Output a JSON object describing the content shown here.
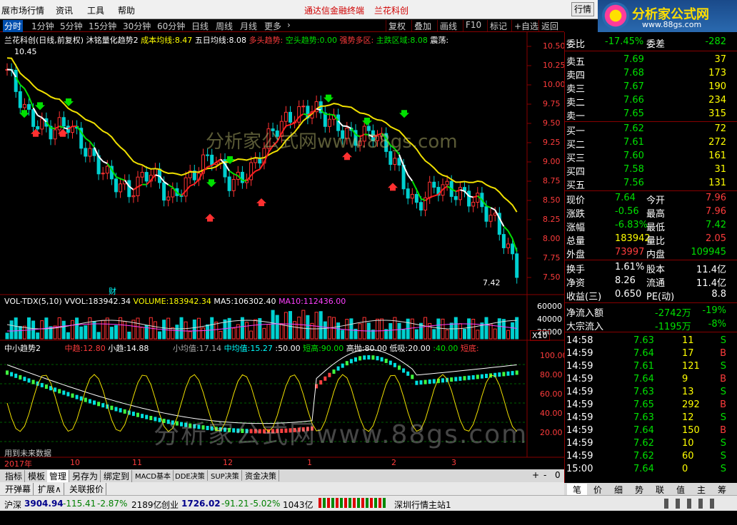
{
  "menubar": {
    "items": [
      "展市场行情",
      "资讯",
      "工具",
      "帮助"
    ],
    "center_title": "通达信金融终端",
    "center_stock": "兰花科创",
    "right_btn": "行情"
  },
  "logo": {
    "main": "分析家公式网",
    "url": "www.88gs.com"
  },
  "periods": [
    "分时",
    "1分钟",
    "5分钟",
    "15分钟",
    "30分钟",
    "60分钟",
    "日线",
    "周线",
    "月线",
    "更多",
    "›"
  ],
  "right_buttons": [
    "复权",
    "叠加",
    "画线",
    "F10",
    "标记",
    "+自选",
    "返回"
  ],
  "main_info": {
    "title": "兰花科创(日线,前复权)",
    "indicator": "沐铭量化趋势2",
    "cost_label": "成本均线:",
    "cost_val": "8.47",
    "ma5_label": "五日均线:",
    "ma5_val": "8.08",
    "bull_label": "多头趋势:",
    "bear_label": "空头趋势:",
    "bear_val": "0.00",
    "strong_label": "强势多区:",
    "rise_label": "主跌区域:",
    "rise_val": "8.08",
    "osc_label": "震荡:"
  },
  "main_chart": {
    "high_label": "10.45",
    "low_label": "7.42",
    "fin_mark": "财",
    "price_ticks": [
      "10.50",
      "10.25",
      "10.00",
      "9.75",
      "9.50",
      "9.25",
      "9.00",
      "8.75",
      "8.50",
      "8.25",
      "8.00",
      "7.75",
      "7.50"
    ]
  },
  "vol_info": {
    "title": "VOL-TDX(5,10)",
    "vvol_label": "VVOL:",
    "vvol": "183942.34",
    "volume_label": "VOLUME:",
    "volume": "183942.34",
    "ma5_label": "MA5:",
    "ma5": "106302.40",
    "ma10_label": "MA10:",
    "ma10": "112436.00",
    "ticks": [
      "60000",
      "40000",
      "20000"
    ],
    "unit": "X10"
  },
  "osc_info": {
    "title": "中小趋势2",
    "mid_label": "中趋:",
    "mid": "12.80",
    "small_label": "小趋:",
    "small": "14.88",
    "smallv_label": "小均值:",
    "smallv": "17.14",
    "midv_label": "中均值:",
    "midv": "15.27",
    "l50": ":50.00",
    "short_high_label": "短高:",
    "short_high": "90.00",
    "high_absorb_label": "高抛:",
    "high_absorb": "80.00",
    "low_label": "低吸:",
    "low": "20.00",
    "l40": ":40.00",
    "short_bottom_label": "短底:",
    "ticks": [
      "100.00",
      "80.00",
      "60.00",
      "40.00",
      "20.00"
    ],
    "future_note": "用到未来数据"
  },
  "dates": [
    "2017年",
    "10",
    "11",
    "12",
    "1",
    "2",
    "3"
  ],
  "bottom_tabs": [
    "指标",
    "模板",
    "管理",
    "另存为",
    "绑定到",
    "MACD基本",
    "DDE决策",
    "SUP决策",
    "资金决策"
  ],
  "bottom_tabs2": [
    "开弹幕",
    "扩展∧",
    "关联报价"
  ],
  "bottom_ctrl": [
    "+",
    "-",
    "0"
  ],
  "order_book": {
    "ratio_label": "委比",
    "ratio": "-17.45%",
    "diff_label": "委差",
    "diff": "-282",
    "asks": [
      {
        "label": "卖五",
        "price": "7.69",
        "vol": "37"
      },
      {
        "label": "卖四",
        "price": "7.68",
        "vol": "173"
      },
      {
        "label": "卖三",
        "price": "7.67",
        "vol": "190"
      },
      {
        "label": "卖二",
        "price": "7.66",
        "vol": "234"
      },
      {
        "label": "卖一",
        "price": "7.65",
        "vol": "315"
      }
    ],
    "bids": [
      {
        "label": "买一",
        "price": "7.62",
        "vol": "72"
      },
      {
        "label": "买二",
        "price": "7.61",
        "vol": "272"
      },
      {
        "label": "买三",
        "price": "7.60",
        "vol": "161"
      },
      {
        "label": "买四",
        "price": "7.58",
        "vol": "31"
      },
      {
        "label": "买五",
        "price": "7.56",
        "vol": "131"
      }
    ]
  },
  "quote": [
    {
      "l1": "现价",
      "v1": "7.64",
      "c1": "green",
      "l2": "今开",
      "v2": "7.96",
      "c2": "red"
    },
    {
      "l1": "涨跌",
      "v1": "-0.56",
      "c1": "green",
      "l2": "最高",
      "v2": "7.96",
      "c2": "red"
    },
    {
      "l1": "涨幅",
      "v1": "-6.83%",
      "c1": "green",
      "l2": "最低",
      "v2": "7.42",
      "c2": "green"
    },
    {
      "l1": "总量",
      "v1": "183942",
      "c1": "yellow",
      "l2": "量比",
      "v2": "2.05",
      "c2": "red"
    },
    {
      "l1": "外盘",
      "v1": "73997",
      "c1": "red",
      "l2": "内盘",
      "v2": "109945",
      "c2": "green"
    }
  ],
  "fundamentals": [
    {
      "l1": "换手",
      "v1": "1.61%",
      "l2": "股本",
      "v2": "11.4亿"
    },
    {
      "l1": "净资",
      "v1": "8.26",
      "l2": "流通",
      "v2": "11.4亿"
    },
    {
      "l1": "收益(三)",
      "v1": "0.650",
      "l2": "PE(动)",
      "v2": "8.8"
    }
  ],
  "flows": [
    {
      "label": "净流入额",
      "v": "-2742万",
      "p": "-19%"
    },
    {
      "label": "大宗流入",
      "v": "-1195万",
      "p": "-8%"
    }
  ],
  "ticks": [
    {
      "t": "14:58",
      "p": "7.63",
      "v": "11",
      "d": "S"
    },
    {
      "t": "14:59",
      "p": "7.64",
      "v": "17",
      "d": "B"
    },
    {
      "t": "14:59",
      "p": "7.61",
      "v": "121",
      "d": "S"
    },
    {
      "t": "14:59",
      "p": "7.64",
      "v": "9",
      "d": "B"
    },
    {
      "t": "14:59",
      "p": "7.63",
      "v": "13",
      "d": "S"
    },
    {
      "t": "14:59",
      "p": "7.65",
      "v": "292",
      "d": "B"
    },
    {
      "t": "14:59",
      "p": "7.63",
      "v": "12",
      "d": "S"
    },
    {
      "t": "14:59",
      "p": "7.64",
      "v": "150",
      "d": "B"
    },
    {
      "t": "14:59",
      "p": "7.62",
      "v": "10",
      "d": "S"
    },
    {
      "t": "14:59",
      "p": "7.62",
      "v": "60",
      "d": "S"
    },
    {
      "t": "15:00",
      "p": "7.64",
      "v": "0",
      "d": "S"
    }
  ],
  "rtabs": [
    "笔",
    "价",
    "细",
    "势",
    "联",
    "值",
    "主",
    "筹"
  ],
  "status": {
    "sh_label": "沪深",
    "sh": "3904.94",
    "sh_chg": "-115.41",
    "sh_pct": "-2.87%",
    "sh_amt": "2189亿",
    "cy_label": "创业",
    "cy": "1726.02",
    "cy_chg": "-91.21",
    "cy_pct": "-5.02%",
    "cy_amt": "1043亿",
    "station": "深圳行情主站1"
  },
  "watermark": "分析家公式网www.88gs.com",
  "watermark2": "分析家公式网www.88gs.com"
}
